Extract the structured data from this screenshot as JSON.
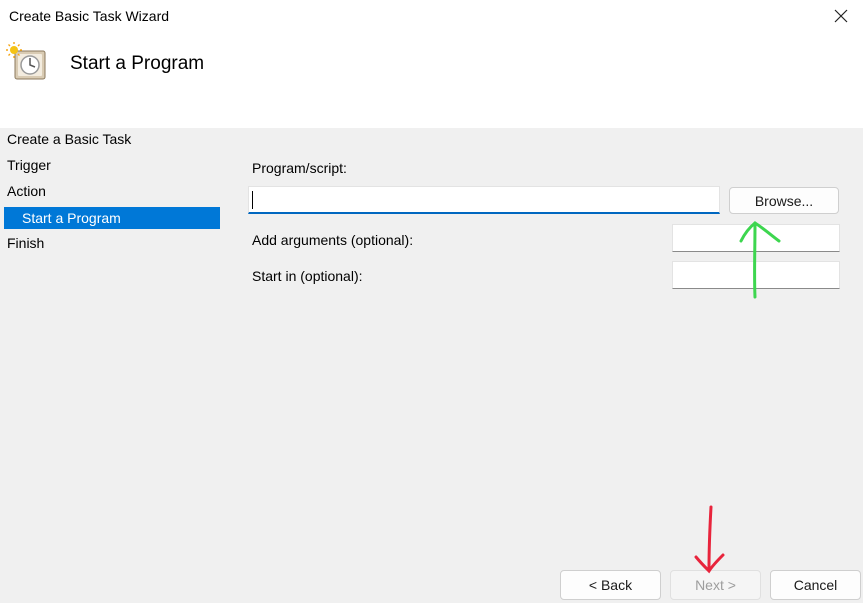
{
  "window": {
    "title": "Create Basic Task Wizard"
  },
  "header": {
    "title": "Start a Program"
  },
  "sidebar": {
    "items": [
      {
        "label": "Create a Basic Task"
      },
      {
        "label": "Trigger"
      },
      {
        "label": "Action"
      },
      {
        "label": "Start a Program",
        "selected": true
      },
      {
        "label": "Finish"
      }
    ]
  },
  "form": {
    "program_label": "Program/script:",
    "program_value": "",
    "browse_label": "Browse...",
    "arguments_label": "Add arguments (optional):",
    "arguments_value": "",
    "start_in_label": "Start in (optional):",
    "start_in_value": ""
  },
  "footer": {
    "back_label": "< Back",
    "next_label": "Next >",
    "next_disabled": true,
    "cancel_label": "Cancel"
  },
  "colors": {
    "accent": "#0078d7",
    "annotation_green": "#3dd64f",
    "annotation_red": "#e8243c"
  },
  "icons": [
    "task-scheduler-icon",
    "close-icon"
  ]
}
